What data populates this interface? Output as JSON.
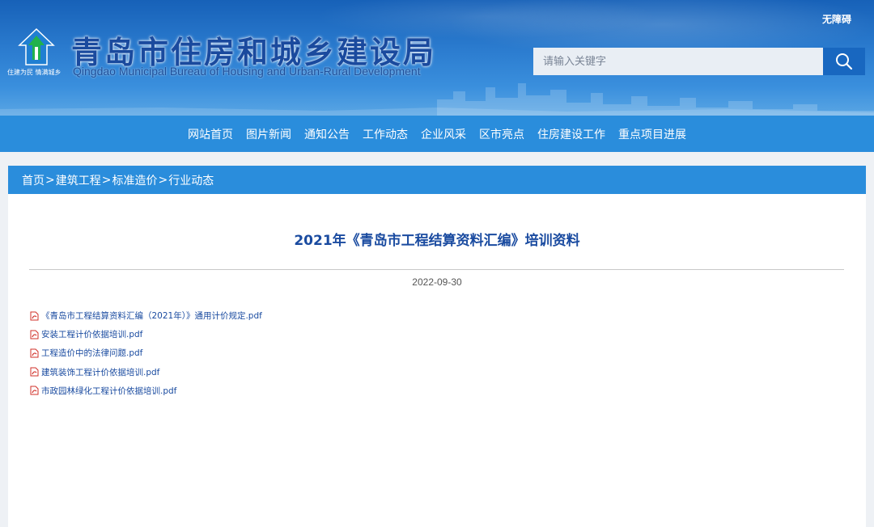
{
  "header": {
    "site_title": "青岛市住房和城乡建设局",
    "site_subtitle": "Qingdao Municipal Bureau of Housing and Urban-Rural Development",
    "slogan": "住建为民 情满城乡",
    "accessibility_label": "无障碍",
    "search_placeholder": "请输入关键字"
  },
  "nav": {
    "items": [
      "网站首页",
      "图片新闻",
      "通知公告",
      "工作动态",
      "企业风采",
      "区市亮点",
      "住房建设工作",
      "重点项目进展"
    ]
  },
  "breadcrumb": {
    "items": [
      "首页",
      "建筑工程",
      "标准造价",
      "行业动态"
    ],
    "separator": ">"
  },
  "article": {
    "title": "2021年《青岛市工程结算资料汇编》培训资料",
    "date": "2022-09-30",
    "attachments": [
      "《青岛市工程结算资料汇编（2021年）》通用计价规定.pdf",
      "安装工程计价依据培训.pdf",
      "工程造价中的法律问题.pdf",
      "建筑装饰工程计价依据培训.pdf",
      "市政园林绿化工程计价依据培训.pdf"
    ]
  },
  "colors": {
    "nav_bar": "#2a8ddc",
    "title_text": "#1a4ba0",
    "search_button": "#1867c0",
    "pdf_icon": "#d0302a"
  },
  "icons": {
    "search": "search-icon",
    "attachment": "pdf-file-icon",
    "emblem": "bureau-emblem-icon"
  }
}
